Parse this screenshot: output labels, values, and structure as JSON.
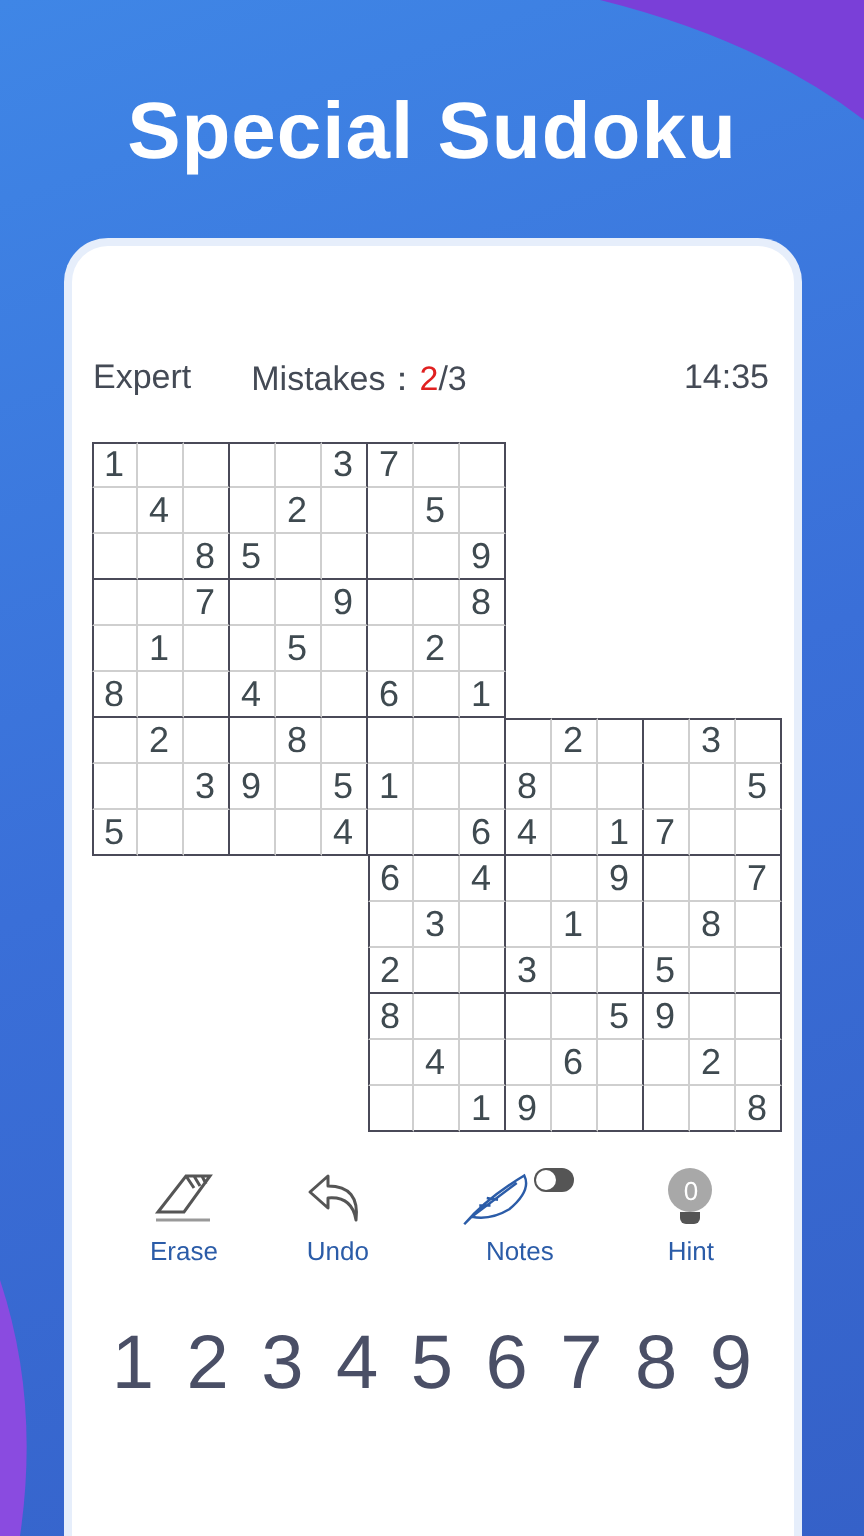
{
  "header": {
    "title": "Special Sudoku"
  },
  "status": {
    "difficulty": "Expert",
    "mistakes_label": "Mistakes：",
    "mistakes": "2",
    "mistakes_max": "/3",
    "time": "14:35"
  },
  "board": {
    "rows": [
      [
        "1",
        null,
        null,
        null,
        null,
        "3",
        "7",
        null,
        null
      ],
      [
        null,
        "4",
        null,
        null,
        "2",
        null,
        null,
        "5",
        null
      ],
      [
        null,
        null,
        "8",
        "5",
        null,
        null,
        null,
        null,
        "9"
      ],
      [
        null,
        null,
        "7",
        null,
        null,
        "9",
        null,
        null,
        "8"
      ],
      [
        null,
        "1",
        null,
        null,
        "5",
        null,
        null,
        "2",
        null
      ],
      [
        "8",
        null,
        null,
        "4",
        null,
        null,
        "6",
        null,
        "1"
      ],
      [
        null,
        "2",
        null,
        null,
        "8",
        null,
        null,
        null,
        null,
        null,
        "2",
        null,
        null,
        "3",
        null
      ],
      [
        null,
        null,
        "3",
        "9",
        null,
        "5",
        "1",
        null,
        null,
        "8",
        null,
        null,
        null,
        null,
        "5"
      ],
      [
        "5",
        null,
        null,
        null,
        null,
        "4",
        null,
        null,
        "6",
        "4",
        null,
        "1",
        "7",
        null,
        null
      ],
      [
        "6",
        null,
        "4",
        null,
        null,
        "9",
        null,
        null,
        "7"
      ],
      [
        null,
        "3",
        null,
        null,
        "1",
        null,
        null,
        "8",
        null
      ],
      [
        "2",
        null,
        null,
        "3",
        null,
        null,
        "5",
        null,
        null
      ],
      [
        "8",
        null,
        null,
        null,
        null,
        "5",
        "9",
        null,
        null
      ],
      [
        null,
        "4",
        null,
        null,
        "6",
        null,
        null,
        "2",
        null
      ],
      [
        null,
        null,
        "1",
        "9",
        null,
        null,
        null,
        null,
        "8"
      ]
    ]
  },
  "tools": [
    {
      "kind": "erase",
      "label": "Erase"
    },
    {
      "kind": "undo",
      "label": "Undo"
    },
    {
      "kind": "notes",
      "label": "Notes",
      "on": false
    },
    {
      "kind": "hint",
      "label": "Hint",
      "count": "0"
    }
  ],
  "numpad": [
    "1",
    "2",
    "3",
    "4",
    "5",
    "6",
    "7",
    "8",
    "9"
  ]
}
